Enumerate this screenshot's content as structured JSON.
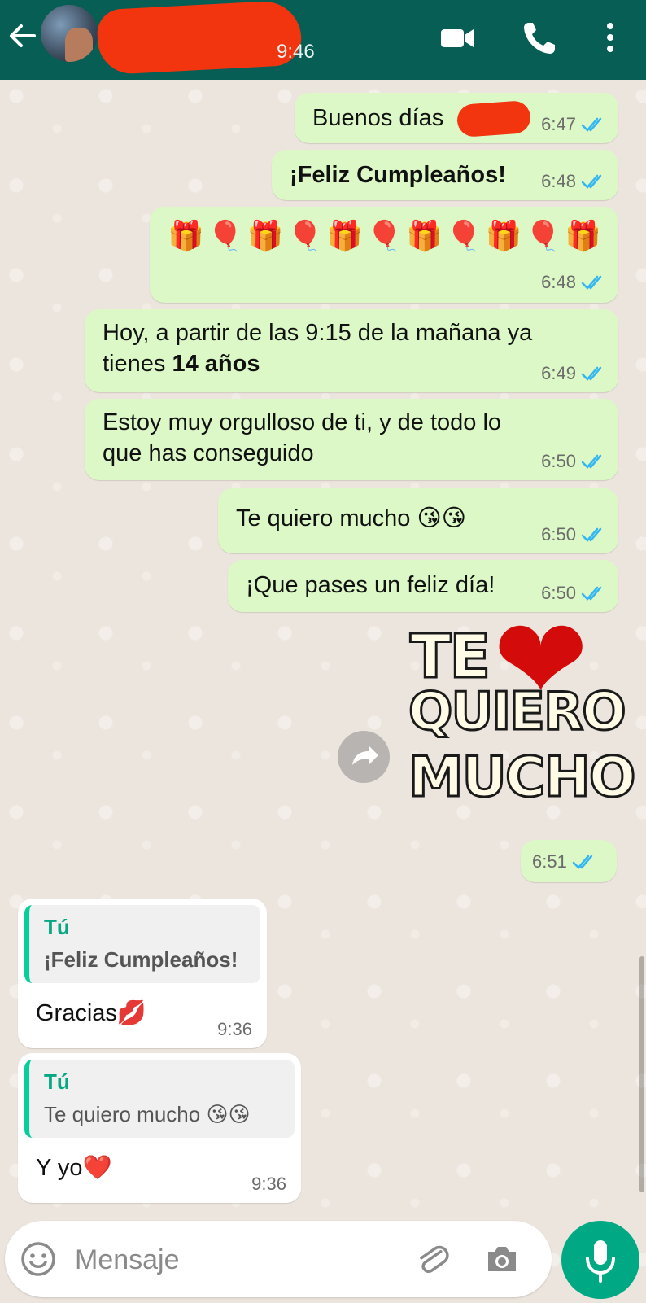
{
  "header": {
    "contact_time": "9:46",
    "icons": [
      "back-arrow-icon",
      "video-call-icon",
      "phone-icon",
      "more-vert-icon"
    ]
  },
  "messages": [
    {
      "text": "Buenos días",
      "time": "6:47"
    },
    {
      "text": "¡Feliz Cumpleaños!",
      "time": "6:48"
    },
    {
      "text": "🎁🎈🎁🎈🎁🎈🎁🎈🎁🎈🎁",
      "time": "6:48"
    },
    {
      "text_line1": "Hoy, a partir de las 9:15 de la mañana ya",
      "text_line2_a": "tienes ",
      "text_line2_b": "14 años",
      "time": "6:49"
    },
    {
      "text_line1": "Estoy muy orgulloso de ti, y de todo lo",
      "text_line2": "que has conseguido",
      "time": "6:50"
    },
    {
      "text": "Te quiero mucho 😘😘",
      "time": "6:50"
    },
    {
      "text": "¡Que pases un feliz día!",
      "time": "6:50"
    }
  ],
  "sticker": {
    "line1": "TE",
    "line2": "QUIERO",
    "line3": "MUCHO",
    "heart": "❤",
    "time": "6:51"
  },
  "replies": [
    {
      "quote_author": "Tú",
      "quote_text": "¡Feliz Cumpleaños!",
      "text": "Gracias💋",
      "time": "9:36"
    },
    {
      "quote_author": "Tú",
      "quote_text": "Te quiero mucho 😘😘",
      "text": "Y yo❤️",
      "time": "9:36"
    }
  ],
  "input": {
    "placeholder": "Mensaje"
  },
  "colors": {
    "header": "#075e54",
    "outgoing_bubble": "#dcf8c6",
    "incoming_bubble": "#ffffff",
    "read_ticks": "#34b7f1",
    "accent": "#00a884"
  }
}
